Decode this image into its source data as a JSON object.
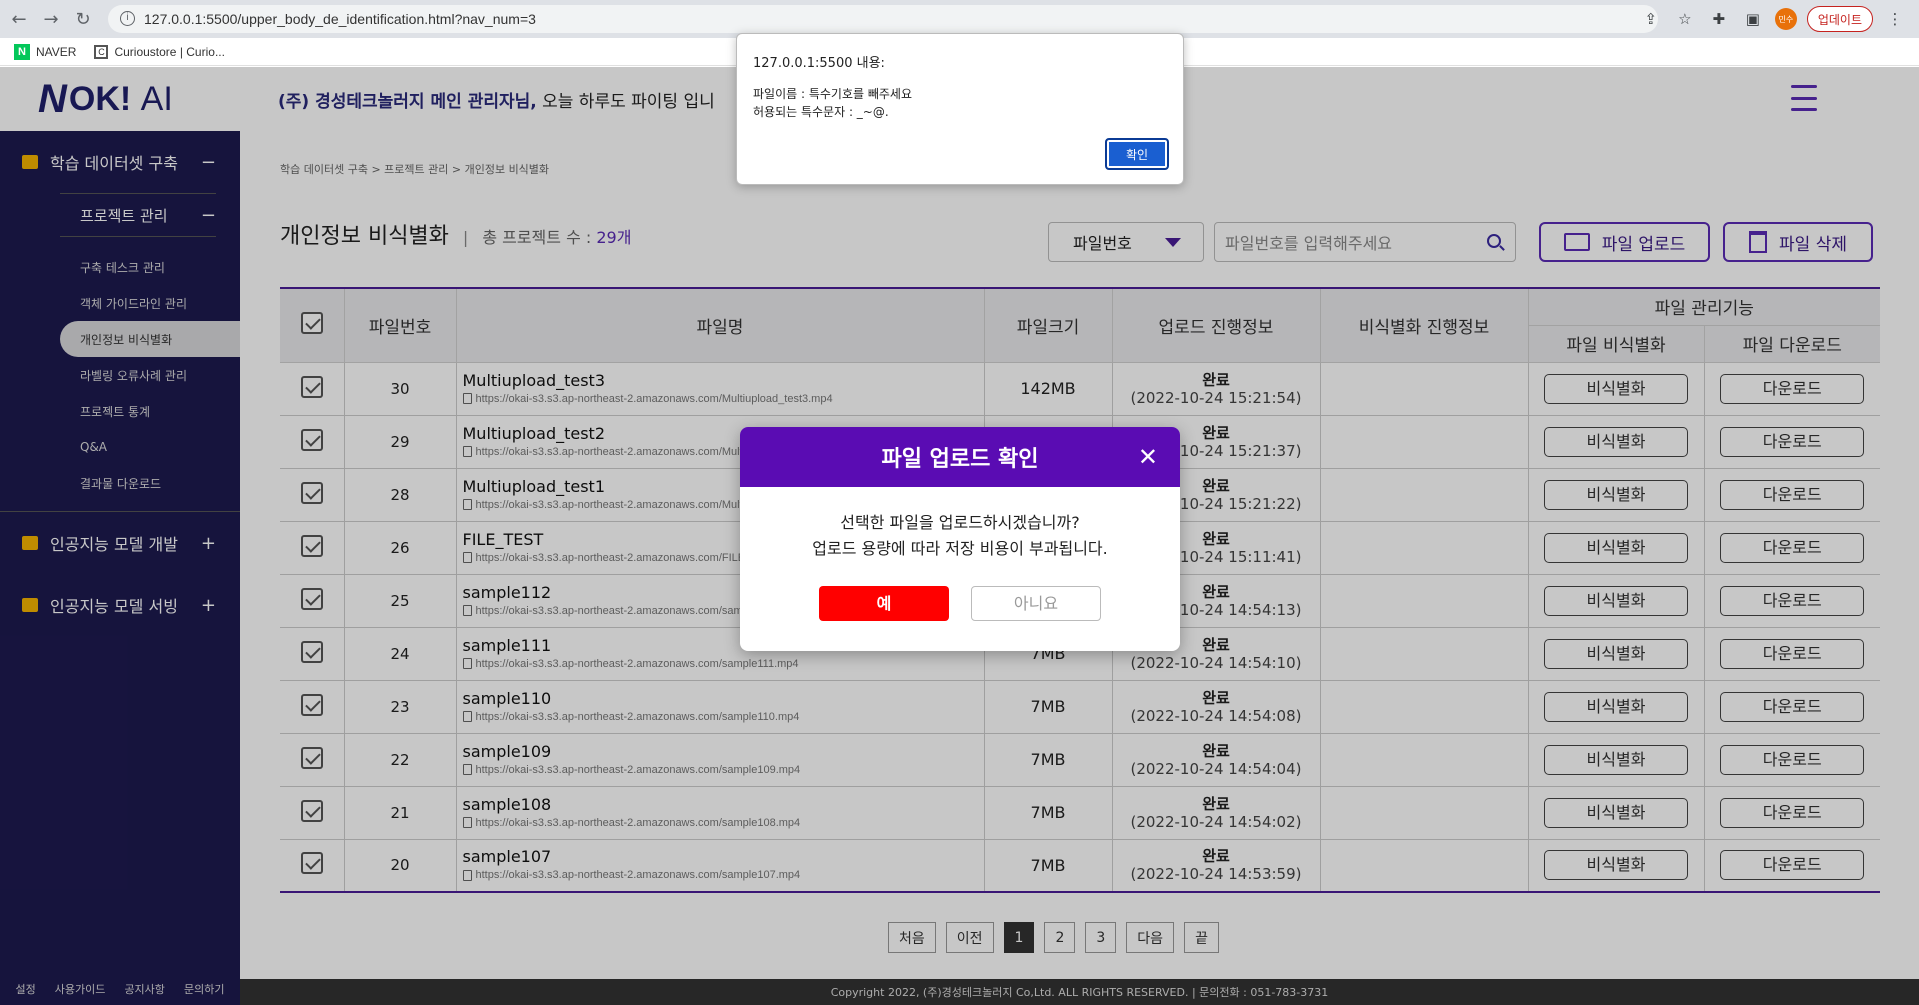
{
  "browser": {
    "url": "127.0.0.1:5500/upper_body_de_identification.html?nav_num=3",
    "profile": "민수",
    "update_label": "업데이트",
    "bookmarks": [
      "NAVER",
      "Curioustore | Curio..."
    ]
  },
  "header": {
    "logo_mark": "N",
    "logo_ok": "OK!",
    "logo_ai": "AI",
    "welcome_bold": "(주) 경성테크놀러지 메인 관리자님,",
    "welcome_rest": " 오늘 하루도 파이팅 입니"
  },
  "sidebar": {
    "section1": "학습 데이터셋 구축",
    "section1_toggle": "−",
    "sub": "프로젝트 관리",
    "sub_toggle": "−",
    "items": [
      "구축 테스크 관리",
      "객체 가이드라인 관리",
      "개인정보 비식별화",
      "라벨링 오류사례 관리",
      "프로젝트 통계",
      "Q&A",
      "결과물 다운로드"
    ],
    "active_index": 2,
    "section2": "인공지능 모델 개발",
    "section2_toggle": "+",
    "section3": "인공지능 모델 서빙",
    "section3_toggle": "+",
    "footer": [
      "설정",
      "사용가이드",
      "공지사항",
      "문의하기"
    ]
  },
  "main": {
    "breadcrumb": "학습 데이터셋 구축 > 프로젝트 관리 > 개인정보 비식별화",
    "title": "개인정보 비식별화",
    "count_label": "총 프로젝트 수 : ",
    "count_value": "29개",
    "select_value": "파일번호",
    "search_placeholder": "파일번호를 입력해주세요",
    "upload_label": "파일 업로드",
    "delete_label": "파일 삭제"
  },
  "table": {
    "headers": {
      "no": "파일번호",
      "name": "파일명",
      "size": "파일크기",
      "upload": "업로드 진행정보",
      "deid": "비식별화 진행정보",
      "manage": "파일 관리기능",
      "manage_deid": "파일 비식별화",
      "manage_download": "파일 다운로드"
    },
    "deid_button": "비식별화",
    "download_button": "다운로드",
    "rows": [
      {
        "no": "30",
        "name": "Multiupload_test3",
        "url": "https://okai-s3.s3.ap-northeast-2.amazonaws.com/Multiupload_test3.mp4",
        "size": "142MB",
        "status": "완료",
        "time": "(2022-10-24 15:21:54)"
      },
      {
        "no": "29",
        "name": "Multiupload_test2",
        "url": "https://okai-s3.s3.ap-northeast-2.amazonaws.com/Multiupload_test2.mp4",
        "size": "",
        "status": "완료",
        "time": "(2022-10-24 15:21:37)"
      },
      {
        "no": "28",
        "name": "Multiupload_test1",
        "url": "https://okai-s3.s3.ap-northeast-2.amazonaws.com/Multiupload_test1.mp4",
        "size": "",
        "status": "완료",
        "time": "(2022-10-24 15:21:22)"
      },
      {
        "no": "26",
        "name": "FILE_TEST",
        "url": "https://okai-s3.s3.ap-northeast-2.amazonaws.com/FILE_TEST.mp4",
        "size": "",
        "status": "완료",
        "time": "(2022-10-24 15:11:41)"
      },
      {
        "no": "25",
        "name": "sample112",
        "url": "https://okai-s3.s3.ap-northeast-2.amazonaws.com/sample112.mp4",
        "size": "",
        "status": "완료",
        "time": "(2022-10-24 14:54:13)"
      },
      {
        "no": "24",
        "name": "sample111",
        "url": "https://okai-s3.s3.ap-northeast-2.amazonaws.com/sample111.mp4",
        "size": "7MB",
        "status": "완료",
        "time": "(2022-10-24 14:54:10)"
      },
      {
        "no": "23",
        "name": "sample110",
        "url": "https://okai-s3.s3.ap-northeast-2.amazonaws.com/sample110.mp4",
        "size": "7MB",
        "status": "완료",
        "time": "(2022-10-24 14:54:08)"
      },
      {
        "no": "22",
        "name": "sample109",
        "url": "https://okai-s3.s3.ap-northeast-2.amazonaws.com/sample109.mp4",
        "size": "7MB",
        "status": "완료",
        "time": "(2022-10-24 14:54:04)"
      },
      {
        "no": "21",
        "name": "sample108",
        "url": "https://okai-s3.s3.ap-northeast-2.amazonaws.com/sample108.mp4",
        "size": "7MB",
        "status": "완료",
        "time": "(2022-10-24 14:54:02)"
      },
      {
        "no": "20",
        "name": "sample107",
        "url": "https://okai-s3.s3.ap-northeast-2.amazonaws.com/sample107.mp4",
        "size": "7MB",
        "status": "완료",
        "time": "(2022-10-24 14:53:59)"
      }
    ]
  },
  "pager": [
    "처음",
    "이전",
    "1",
    "2",
    "3",
    "다음",
    "끝"
  ],
  "pager_current": "1",
  "footer": "Copyright 2022, (주)경성테크놀러지 Co,Ltd. ALL RIGHTS RESERVED.  |  문의전화 : 051-783-3731",
  "alert": {
    "title": "127.0.0.1:5500 내용:",
    "line1": "파일이름 : 특수기호를 빼주세요",
    "line2": "허용되는 특수문자 : _~@.",
    "ok": "확인"
  },
  "modal": {
    "title": "파일 업로드 확인",
    "line1": "선택한 파일을 업로드하시겠습니까?",
    "line2": "업로드 용량에 따라 저장 비용이 부과됩니다.",
    "yes": "예",
    "no": "아니요"
  },
  "colors": {
    "accent": "#5a0cb3",
    "sidebar": "#1d1a4f",
    "danger": "#ff0000"
  }
}
